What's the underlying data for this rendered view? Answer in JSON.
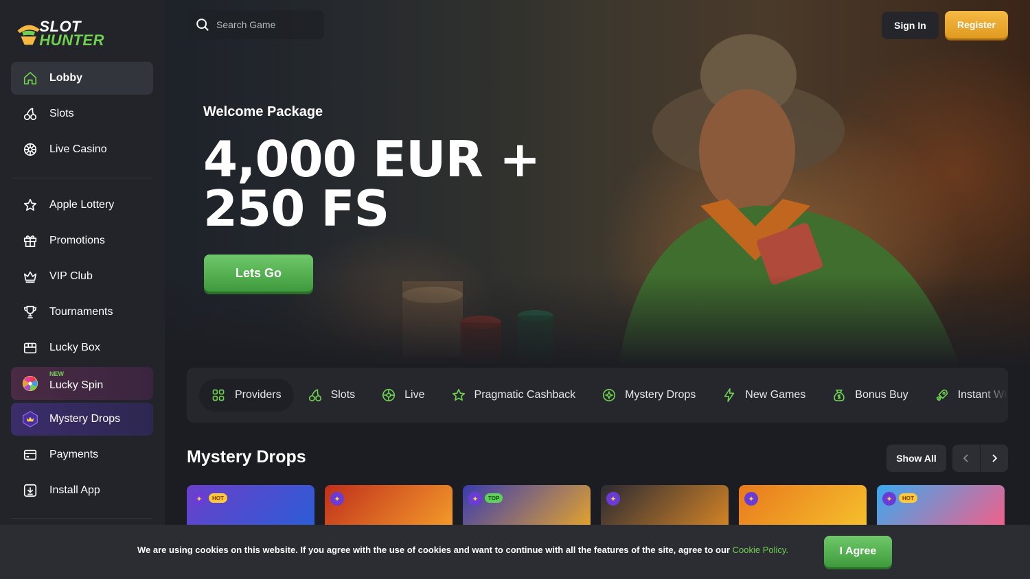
{
  "brand": {
    "line1": "SLOT",
    "line2": "HUNTER"
  },
  "search": {
    "placeholder": "Search Game"
  },
  "header": {
    "sign_in": "Sign In",
    "register": "Register"
  },
  "sidebar": {
    "group1": [
      {
        "label": "Lobby",
        "icon": "home-icon"
      },
      {
        "label": "Slots",
        "icon": "cherries-icon"
      },
      {
        "label": "Live Casino",
        "icon": "roulette-icon"
      }
    ],
    "group2": [
      {
        "label": "Apple Lottery",
        "icon": "star-icon"
      },
      {
        "label": "Promotions",
        "icon": "gift-icon"
      },
      {
        "label": "VIP Club",
        "icon": "crown-icon"
      },
      {
        "label": "Tournaments",
        "icon": "trophy-icon"
      },
      {
        "label": "Lucky Box",
        "icon": "box-icon"
      },
      {
        "label": "Lucky Spin",
        "icon": "wheel-icon",
        "badge": "NEW"
      },
      {
        "label": "Mystery Drops",
        "icon": "mystery-drop-icon"
      },
      {
        "label": "Payments",
        "icon": "card-icon"
      },
      {
        "label": "Install App",
        "icon": "download-icon"
      }
    ]
  },
  "hero": {
    "subtitle": "Welcome Package",
    "line1": "4,000 EUR +",
    "line2": "250 FS",
    "cta": "Lets Go"
  },
  "categories": [
    {
      "label": "Providers",
      "icon": "grid-icon"
    },
    {
      "label": "Slots",
      "icon": "cherries-icon"
    },
    {
      "label": "Live",
      "icon": "roulette-icon"
    },
    {
      "label": "Pragmatic Cashback",
      "icon": "star-icon"
    },
    {
      "label": "Mystery Drops",
      "icon": "sparkle-icon"
    },
    {
      "label": "New Games",
      "icon": "bolt-icon"
    },
    {
      "label": "Bonus Buy",
      "icon": "moneybag-icon"
    },
    {
      "label": "Instant Wi",
      "icon": "rocket-icon"
    }
  ],
  "section": {
    "title": "Mystery Drops",
    "show_all": "Show All",
    "games": [
      {
        "tag": "HOT",
        "colors": [
          "#6a3fc9",
          "#2c5dd6"
        ]
      },
      {
        "tag": "",
        "colors": [
          "#c0301c",
          "#f39a2a"
        ]
      },
      {
        "tag": "TOP",
        "colors": [
          "#3a3cb0",
          "#e2a22e"
        ]
      },
      {
        "tag": "",
        "colors": [
          "#2b2a33",
          "#d38426"
        ]
      },
      {
        "tag": "",
        "colors": [
          "#e8791d",
          "#f6c02c"
        ]
      },
      {
        "tag": "HOT",
        "colors": [
          "#39a9f0",
          "#f2608a"
        ]
      }
    ]
  },
  "cookie": {
    "text": "We are using cookies on this website. If you agree with the use of cookies and want to continue with all the features of the site, agree to our",
    "link": "Cookie Policy.",
    "agree": "I Agree"
  },
  "colors": {
    "accent_green": "#6fd14f",
    "register_gold": "#f0a82e",
    "bg": "#1c1d22",
    "sidebar": "#22242a"
  }
}
